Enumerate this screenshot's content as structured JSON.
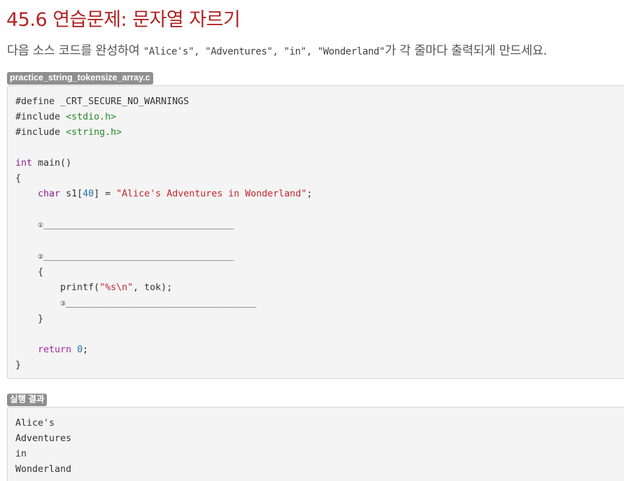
{
  "title": "45.6 연습문제: 문자열 자르기",
  "description": {
    "prefix": "다음 소스 코드를 완성하여 ",
    "code": "\"Alice's\", \"Adventures\", \"in\", \"Wonderland\"",
    "suffix": "가 각 줄마다 출력되게 만드세요."
  },
  "source": {
    "filename": "practice_string_tokensize_array.c",
    "lines": {
      "l1": "#define _CRT_SECURE_NO_WARNINGS",
      "l2_kw": "#include ",
      "l2_path": "<stdio.h>",
      "l3_kw": "#include ",
      "l3_path": "<string.h>",
      "l5_type": "int",
      "l5_rest": " main()",
      "l6": "{",
      "l7_indent": "    ",
      "l7_type": "char",
      "l7_a": " s1[",
      "l7_num": "40",
      "l7_b": "] = ",
      "l7_str": "\"Alice's Adventures in Wonderland\"",
      "l7_end": ";",
      "blank1_num": "①",
      "blank1": "__________________________________",
      "blank2_num": "②",
      "blank2": "__________________________________",
      "l13": "    {",
      "l14_a": "        printf(",
      "l14_str1": "\"%s",
      "l14_esc": "\\n",
      "l14_str2": "\"",
      "l14_b": ", tok);",
      "blank3_num": "③",
      "blank3": "__________________________________",
      "l16": "    }",
      "l18_kw": "return",
      "l18_num": "0",
      "l18_end": ";",
      "l19": "}"
    }
  },
  "result": {
    "label": "실행 결과",
    "lines": [
      "Alice's",
      "Adventures",
      "in",
      "Wonderland"
    ]
  }
}
